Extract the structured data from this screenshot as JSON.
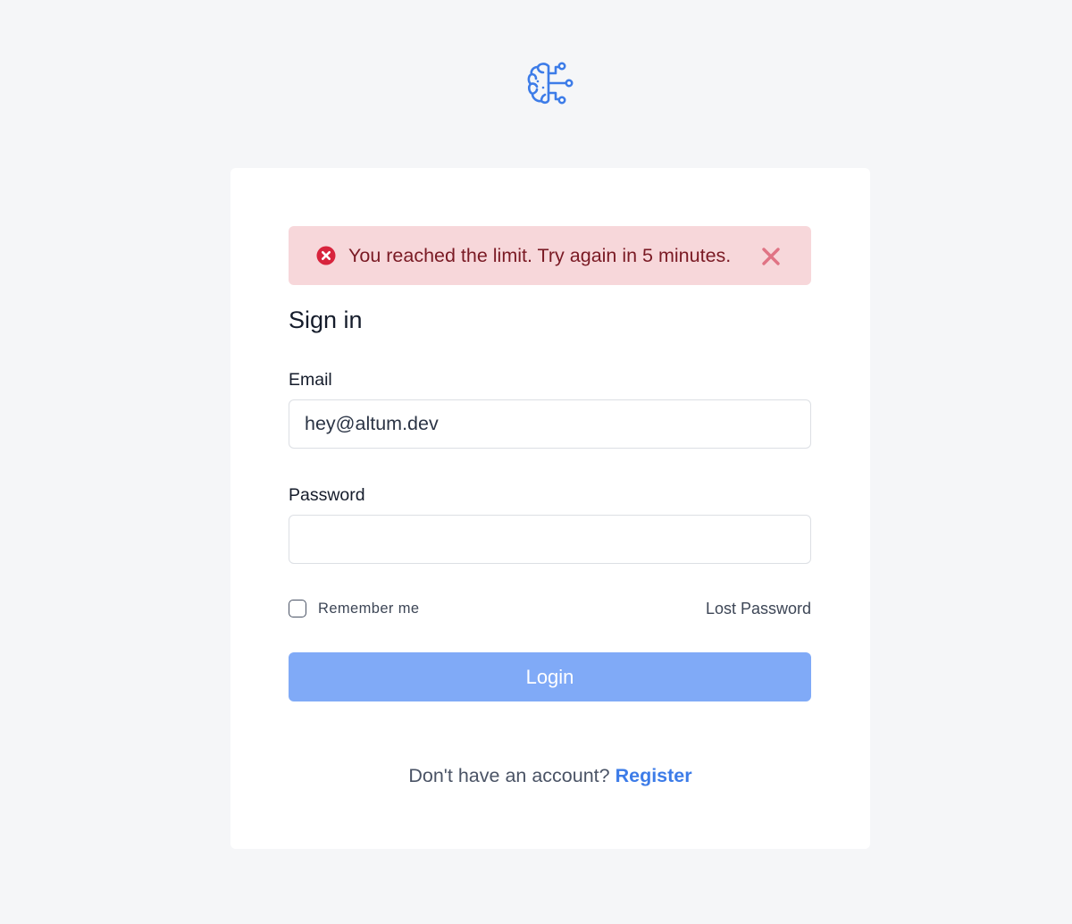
{
  "brand": {
    "logo_icon": "brain-circuit-icon",
    "logo_color": "#3d7ce8"
  },
  "alert": {
    "icon": "error-circle-icon",
    "message": "You reached the limit. Try again in 5 minutes.",
    "close_icon": "close-icon",
    "background": "#f7d7da",
    "text_color": "#7a1a24",
    "icon_color": "#d8243d"
  },
  "form": {
    "title": "Sign in",
    "email": {
      "label": "Email",
      "value": "hey@altum.dev",
      "placeholder": ""
    },
    "password": {
      "label": "Password",
      "value": "",
      "placeholder": ""
    },
    "remember_me": {
      "label": "Remember me",
      "checked": false
    },
    "lost_password": "Lost Password",
    "login_button": "Login",
    "login_button_color": "#80aaf7"
  },
  "footer": {
    "prompt": "Don't have an account?",
    "register_link": "Register",
    "link_color": "#3d7ce8"
  }
}
